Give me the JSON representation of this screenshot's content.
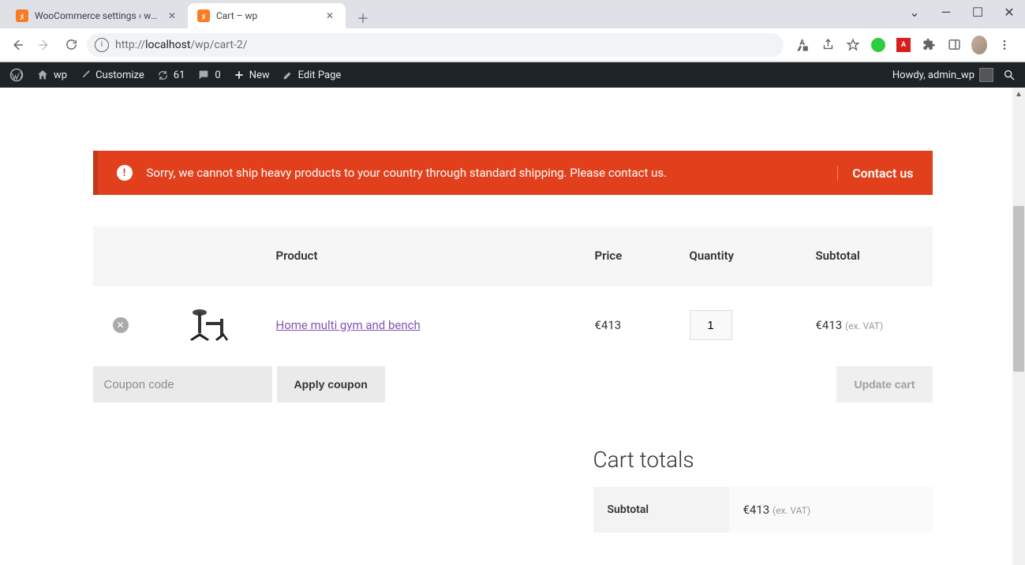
{
  "browser": {
    "tabs": [
      {
        "title": "WooCommerce settings ‹ wp — W",
        "active": false
      },
      {
        "title": "Cart – wp",
        "active": true
      }
    ],
    "url_host": "localhost",
    "url_prefix": "http://",
    "url_path": "/wp/cart-2/"
  },
  "wpbar": {
    "site": "wp",
    "customize": "Customize",
    "updates": "61",
    "comments": "0",
    "new": "New",
    "edit": "Edit Page",
    "howdy": "Howdy, admin_wp"
  },
  "notice": {
    "text": "Sorry, we cannot ship heavy products to your country through standard shipping. Please contact us.",
    "action": "Contact us"
  },
  "cart": {
    "headers": {
      "product": "Product",
      "price": "Price",
      "quantity": "Quantity",
      "subtotal": "Subtotal"
    },
    "items": [
      {
        "name": "Home multi gym and bench",
        "price": "€413",
        "qty": "1",
        "subtotal": "€413",
        "tax_note": "(ex. VAT)"
      }
    ],
    "coupon_placeholder": "Coupon code",
    "apply_coupon": "Apply coupon",
    "update_cart": "Update cart"
  },
  "totals": {
    "heading": "Cart totals",
    "subtotal_label": "Subtotal",
    "subtotal_value": "€413",
    "subtotal_tax": "(ex. VAT)"
  }
}
